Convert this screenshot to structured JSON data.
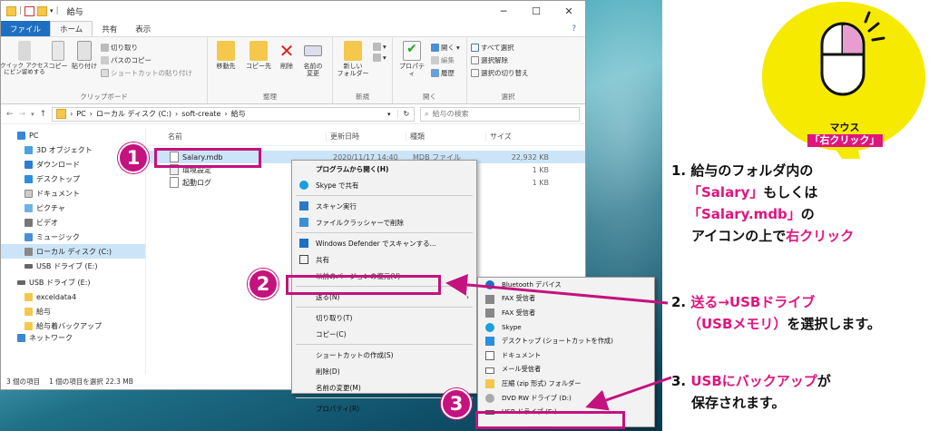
{
  "window": {
    "title": "給与",
    "tabs": [
      "ファイル",
      "ホーム",
      "共有",
      "表示"
    ],
    "ribbon": {
      "clipboard": {
        "label": "クリップボード",
        "quick": "クイック アクセス\nにピン留めする",
        "copy": "コピー",
        "paste": "貼り付け",
        "cut": "切り取り",
        "copy_path": "パスのコピー",
        "paste_shortcut": "ショートカットの貼り付け"
      },
      "organize": {
        "label": "整理",
        "move": "移動先",
        "copyto": "コピー先",
        "delete": "削除",
        "rename": "名前の\n変更"
      },
      "new": {
        "label": "新規",
        "folder": "新しい\nフォルダー"
      },
      "open": {
        "label": "開く",
        "props": "プロパティ",
        "open": "開く",
        "edit": "編集",
        "history": "履歴"
      },
      "select": {
        "label": "選択",
        "all": "すべて選択",
        "none": "選択解除",
        "invert": "選択の切り替え"
      }
    },
    "address": [
      "PC",
      "ローカル ディスク (C:)",
      "soft-create",
      "給与"
    ],
    "search_placeholder": "給与の検索",
    "columns": [
      "名前",
      "更新日時",
      "種類",
      "サイズ"
    ],
    "files": [
      {
        "name": "Salary.mdb",
        "date": "2020/11/17 14:40",
        "type": "MDB ファイル",
        "size": "22,932 KB"
      },
      {
        "name": "環境設定",
        "date": "",
        "type": "",
        "size": "1 KB"
      },
      {
        "name": "起動ログ",
        "date": "",
        "type": "",
        "size": "1 KB"
      }
    ],
    "nav": [
      "PC",
      "3D オブジェクト",
      "ダウンロード",
      "デスクトップ",
      "ドキュメント",
      "ピクチャ",
      "ビデオ",
      "ミュージック",
      "ローカル ディスク (C:)",
      "USB ドライブ (E:)",
      "USB ドライブ (E:)",
      "exceldata4",
      "給与",
      "給与着バックアップ",
      "ネットワーク"
    ],
    "status": {
      "count": "3 個の項目",
      "selected": "1 個の項目を選択 22.3 MB"
    }
  },
  "context_menu": [
    "プログラムから開く(H)",
    "Skype で共有",
    "スキャン実行",
    "ファイルクラッシャーで削除",
    "Windows Defender でスキャンする...",
    "共有",
    "以前のバージョンの復元(V)",
    "送る(N)",
    "切り取り(T)",
    "コピー(C)",
    "ショートカットの作成(S)",
    "削除(D)",
    "名前の変更(M)",
    "プロパティ(R)"
  ],
  "sendto_menu": [
    "Bluetooth デバイス",
    "FAX 受信者",
    "FAX 受信者",
    "Skype",
    "デスクトップ (ショートカットを作成)",
    "ドキュメント",
    "メール受信者",
    "圧縮 (zip 形式) フォルダー",
    "DVD RW ドライブ (D:)",
    "USB ドライブ (E:)"
  ],
  "callout": {
    "line1": "マウス",
    "line2": "「右クリック」"
  },
  "steps": {
    "n1": "1",
    "n2": "2",
    "n3": "3",
    "s1_num": "1.",
    "s1_a": "給与のフォルダ内の",
    "s1_b": "「Salary」",
    "s1_c": "もしくは",
    "s1_d": "「Salary.mdb」",
    "s1_e": "の",
    "s1_f": "アイコンの上で",
    "s1_g": "右クリック",
    "s2_num": "2.",
    "s2_a": "送る→USBドライブ",
    "s2_b": "（USBメモリ）",
    "s2_c": "を選択します。",
    "s3_num": "3.",
    "s3_a": "USBにバックアップ",
    "s3_b": "が",
    "s3_c": "保存されます。"
  },
  "colors": {
    "accent": "#c4127e",
    "annotation_pink": "#e0157f",
    "callout_yellow": "#f6ea00",
    "file_tab": "#1e6fc1",
    "selection": "#cce4f7"
  }
}
